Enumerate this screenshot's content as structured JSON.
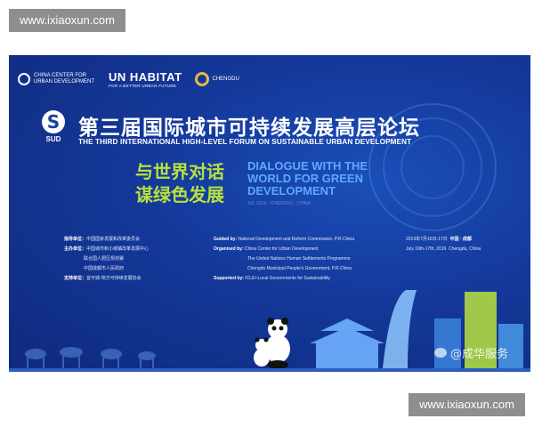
{
  "watermark": {
    "top": "www.ixiaoxun.com",
    "bottom": "www.ixiaoxun.com"
  },
  "logos": {
    "china_center": "CHINA CENTER FOR URBAN DEVELOPMENT",
    "unhabitat": "UN HABITAT",
    "unhabitat_sub": "FOR A BETTER URBAN FUTURE",
    "chengdu": "CHENGDU"
  },
  "sud_label": "SUD",
  "title_cn": "第三届国际城市可持续发展高层论坛",
  "title_en": "THE THIRD INTERNATIONAL HIGH-LEVEL FORUM ON SUSTAINABLE URBAN DEVELOPMENT",
  "theme_cn": [
    "与世界对话",
    "谋绿色发展"
  ],
  "theme_en": "DIALOGUE WITH THE WORLD FOR GREEN DEVELOPMENT",
  "theme_small": "JUL 2019 · CHENGDU · CHINA",
  "info_cn": [
    {
      "label": "指导单位：",
      "value": "中国国家发展和改革委员会"
    },
    {
      "label": "主办单位：",
      "value": "中国城市和小城镇改革发展中心"
    },
    {
      "label": "",
      "value": "联合国人居区规划署"
    },
    {
      "label": "",
      "value": "中国成都市人民政府"
    },
    {
      "label": "支持单位：",
      "value": "宜可城-地方可持续发展协会"
    }
  ],
  "info_en": [
    {
      "label": "Guided by:",
      "value": "National Development and Reform Commission, P.R.China"
    },
    {
      "label": "Organised by:",
      "value": "China Center for Urban Development"
    },
    {
      "label": "",
      "value": "The United Nations Human Settlements Programme"
    },
    {
      "label": "",
      "value": "Chengdu Municipal People's Government, P.R.China"
    },
    {
      "label": "Supported by:",
      "value": "ICLEI-Local Governments for Sustainability"
    }
  ],
  "date_cn": "2019年7月16日-17日",
  "place_cn": "中国 · 成都",
  "date_en": "July 16th-17th, 2019",
  "place_en": "Chengdu, China",
  "weibo_watermark": "@成华服务"
}
